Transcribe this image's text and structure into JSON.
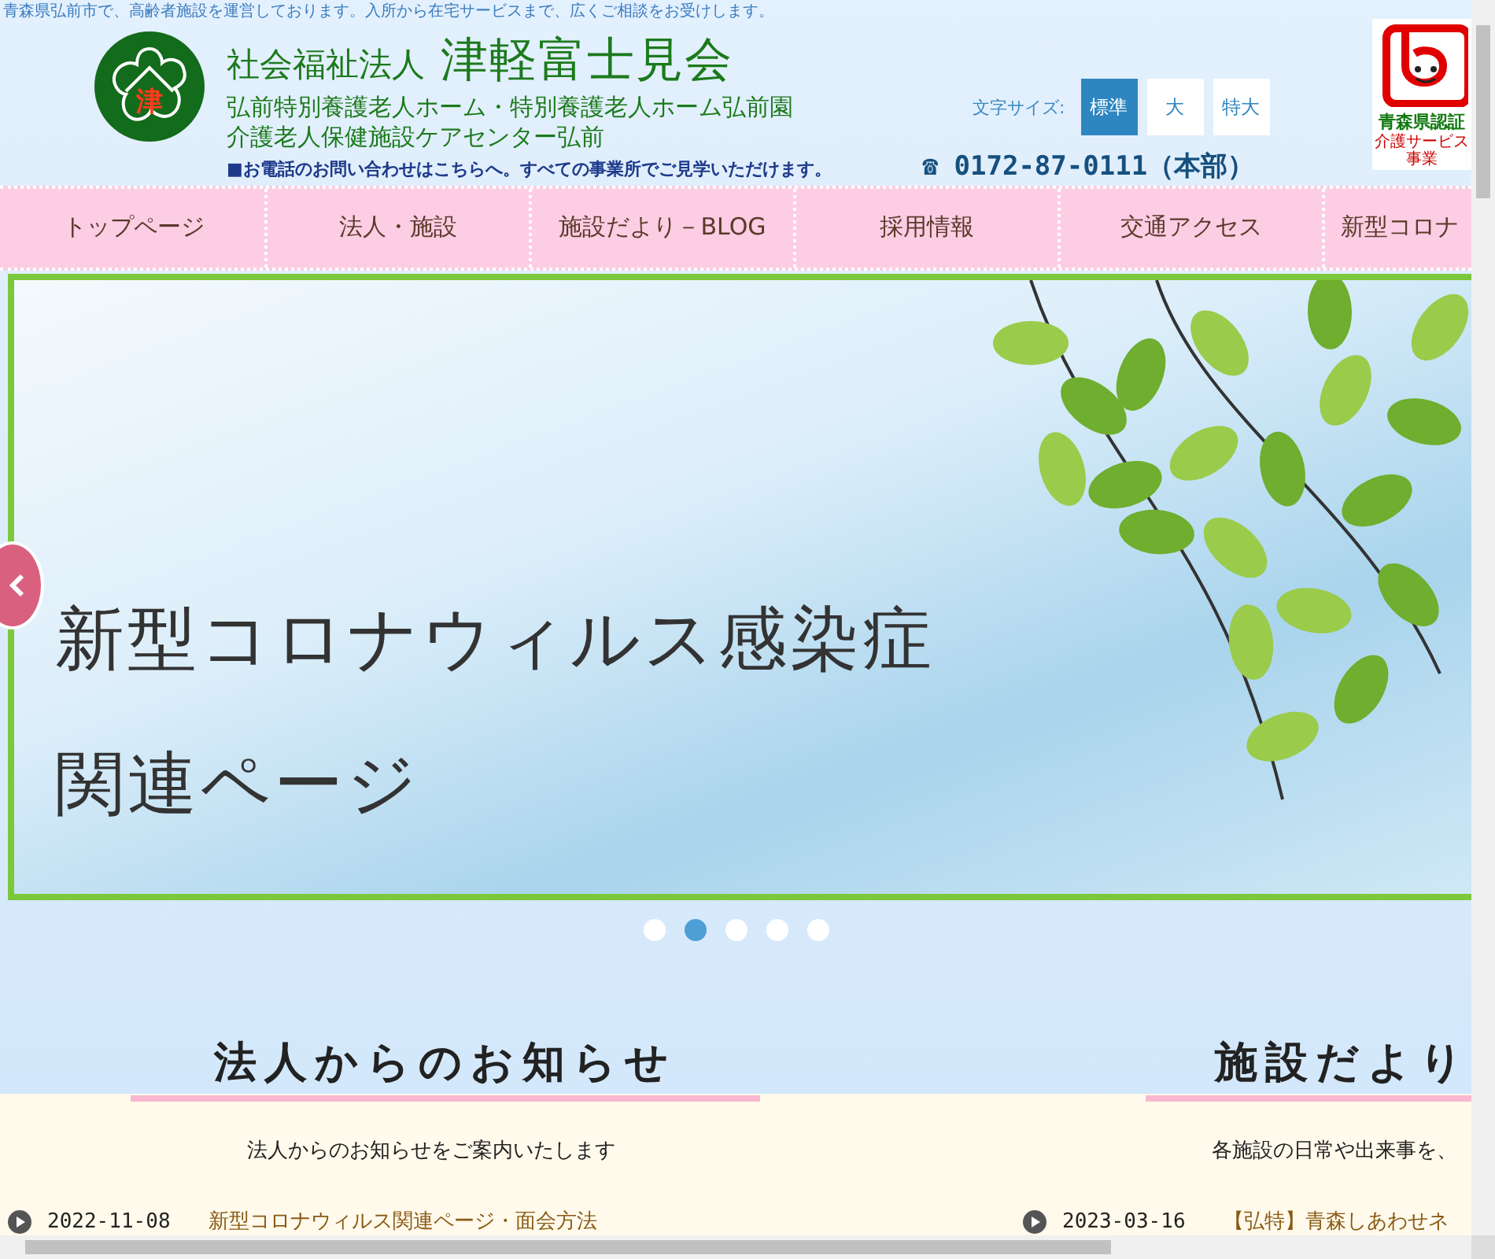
{
  "tagline": "青森県弘前市で、高齢者施設を運営しております。入所から在宅サービスまで、広くご相談をお受けします。",
  "org": {
    "type": "社会福祉法人",
    "name": "津軽富士見会",
    "logo_char": "津",
    "facilities": [
      "弘前特別養護老人ホーム・特別養護老人ホーム弘前園",
      "介護老人保健施設ケアセンター弘前"
    ],
    "notice": "■お電話のお問い合わせはこちらへ。すべての事業所でご見学いただけます。"
  },
  "font_size": {
    "label": "文字サイズ:",
    "options": [
      {
        "label": "標準",
        "selected": true
      },
      {
        "label": "大",
        "selected": false
      },
      {
        "label": "特大",
        "selected": false
      }
    ]
  },
  "phone": {
    "icon": "☎",
    "number": "0172-87-0111（本部）"
  },
  "badge": {
    "title": "青森県認証",
    "subtitle": "介護サービス事業"
  },
  "nav": [
    {
      "label": "トップページ",
      "selected": false
    },
    {
      "label": "法人・施設",
      "selected": false
    },
    {
      "label": "施設だより－BLOG",
      "selected": false
    },
    {
      "label": "採用情報",
      "selected": false
    },
    {
      "label": "交通アクセス",
      "selected": false
    },
    {
      "label": "新型コロナ",
      "selected": false
    }
  ],
  "slider": {
    "headline": [
      "新型コロナウィルス感染症",
      "関連ページ"
    ],
    "dots": [
      {
        "selected": false
      },
      {
        "selected": true
      },
      {
        "selected": false
      },
      {
        "selected": false
      },
      {
        "selected": false
      }
    ]
  },
  "sections": [
    {
      "title": "法人からのお知らせ",
      "intro": "法人からのお知らせをご案内いたします",
      "posts": [
        {
          "date": "2022-11-08",
          "title": "新型コロナウィルス関連ページ・面会方法"
        }
      ]
    },
    {
      "title": "施設だより",
      "intro": "各施設の日常や出来事を、",
      "posts": [
        {
          "date": "2023-03-16",
          "title": "【弘特】青森しあわせネ"
        }
      ]
    }
  ]
}
